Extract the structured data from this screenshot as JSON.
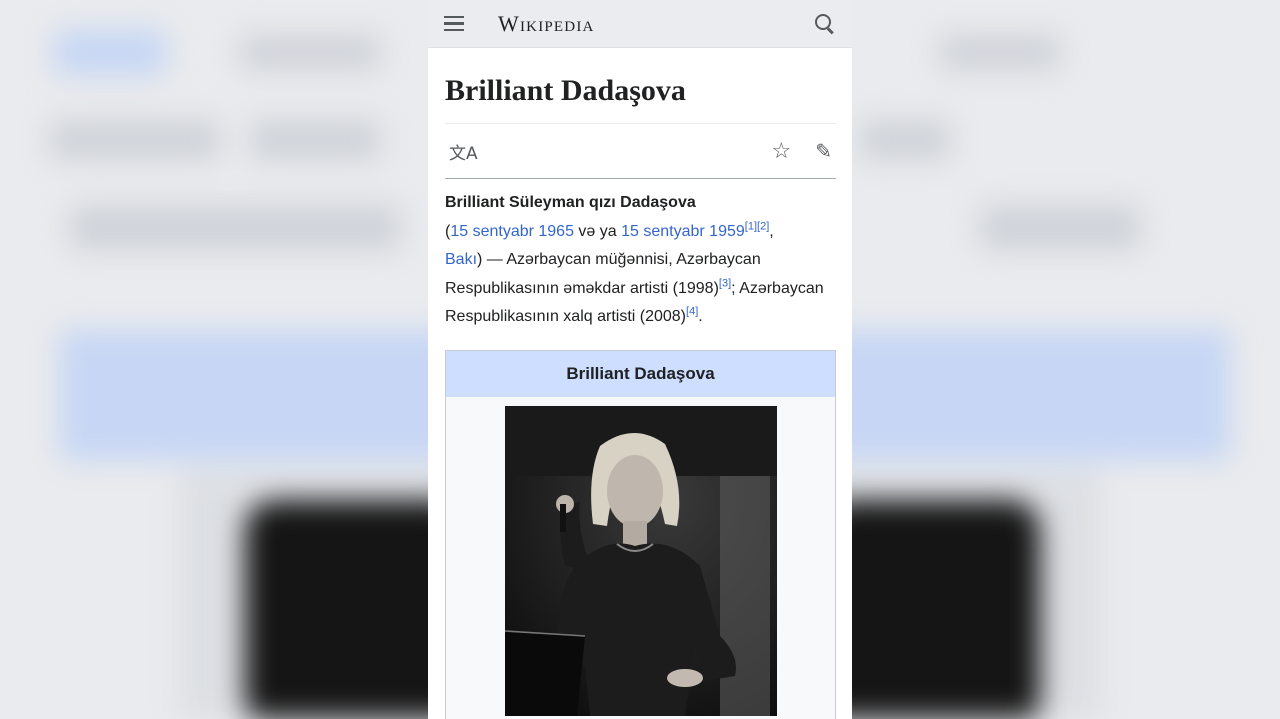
{
  "header": {
    "wordmark": "Wikipedia"
  },
  "article": {
    "title": "Brilliant Dadaşova",
    "lead": {
      "name_bold": "Brilliant Süleyman qızı Dadaşova",
      "open_paren": "(",
      "date1": "15 sentyabr 1965",
      "ve_ya": " və ya ",
      "date2": "15 sentyabr 1959",
      "ref1": "[1]",
      "ref2": "[2]",
      "comma": ",",
      "city": "Bakı",
      "text1": ") — Azərbaycan müğənnisi, Azərbaycan Respublikasının əməkdar artisti (1998)",
      "ref3": "[3]",
      "text2": "; Azərbaycan Respublikasının xalq artisti (2008)",
      "ref4": "[4]",
      "period": "."
    },
    "infobox": {
      "title": "Brilliant Dadaşova"
    }
  },
  "icons": {
    "menu": "hamburger-menu-icon",
    "search": "search-icon",
    "language": "translate-icon",
    "watch": "star-icon",
    "edit": "pencil-icon"
  }
}
